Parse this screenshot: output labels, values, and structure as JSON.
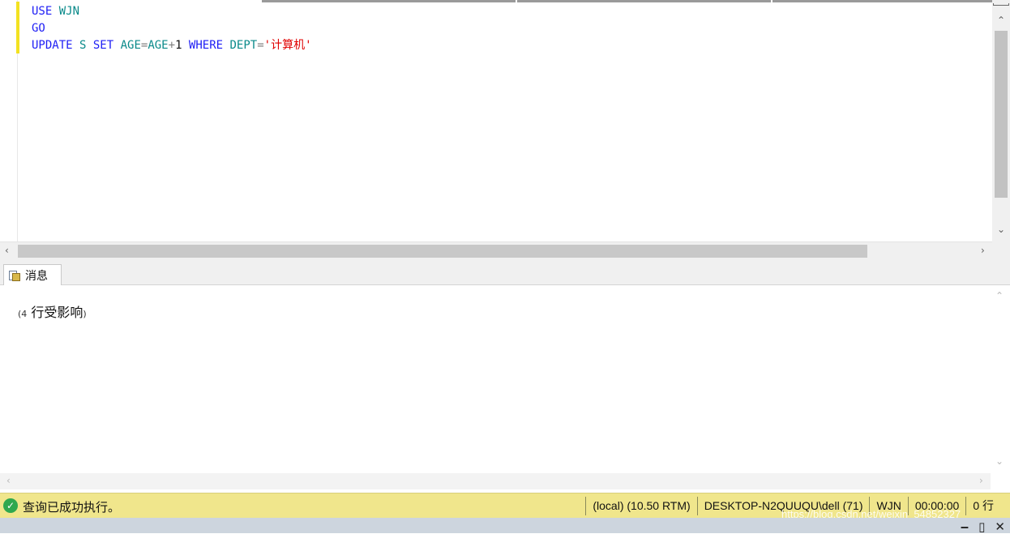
{
  "editor": {
    "lines": [
      [
        {
          "text": "USE",
          "style": "kw"
        },
        {
          "text": " ",
          "style": "plain"
        },
        {
          "text": "WJN",
          "style": "id"
        }
      ],
      [
        {
          "text": "GO",
          "style": "kw"
        }
      ],
      [
        {
          "text": "UPDATE",
          "style": "kw"
        },
        {
          "text": " S ",
          "style": "id"
        },
        {
          "text": "SET",
          "style": "kw"
        },
        {
          "text": " AGE",
          "style": "id"
        },
        {
          "text": "=",
          "style": "op"
        },
        {
          "text": "AGE",
          "style": "id"
        },
        {
          "text": "+",
          "style": "op"
        },
        {
          "text": "1 ",
          "style": "plain"
        },
        {
          "text": "WHERE",
          "style": "kw"
        },
        {
          "text": " DEPT",
          "style": "id"
        },
        {
          "text": "=",
          "style": "op"
        },
        {
          "text": "'计算机'",
          "style": "str"
        }
      ]
    ],
    "scroll_up_icon": "chevron-up",
    "scroll_down_icon": "chevron-down",
    "scroll_left_icon": "chevron-left",
    "scroll_right_icon": "chevron-right"
  },
  "results": {
    "tab_label": "消息",
    "tab_icon": "messages-icon",
    "message_prefix": "(4",
    "message_body": " 行受影响",
    "message_suffix": ")"
  },
  "statusbar": {
    "status_icon": "check-circle",
    "status_text": "查询已成功执行。",
    "cells": [
      "(local) (10.50 RTM)",
      "DESKTOP-N2QUUQU\\dell (71)",
      "WJN",
      "00:00:00",
      "0 行"
    ],
    "background": "#f0e68c",
    "watermark": "https://blog.csdn.net/weixin_54852327"
  },
  "window_controls": [
    "‒",
    "▯",
    "✕"
  ]
}
